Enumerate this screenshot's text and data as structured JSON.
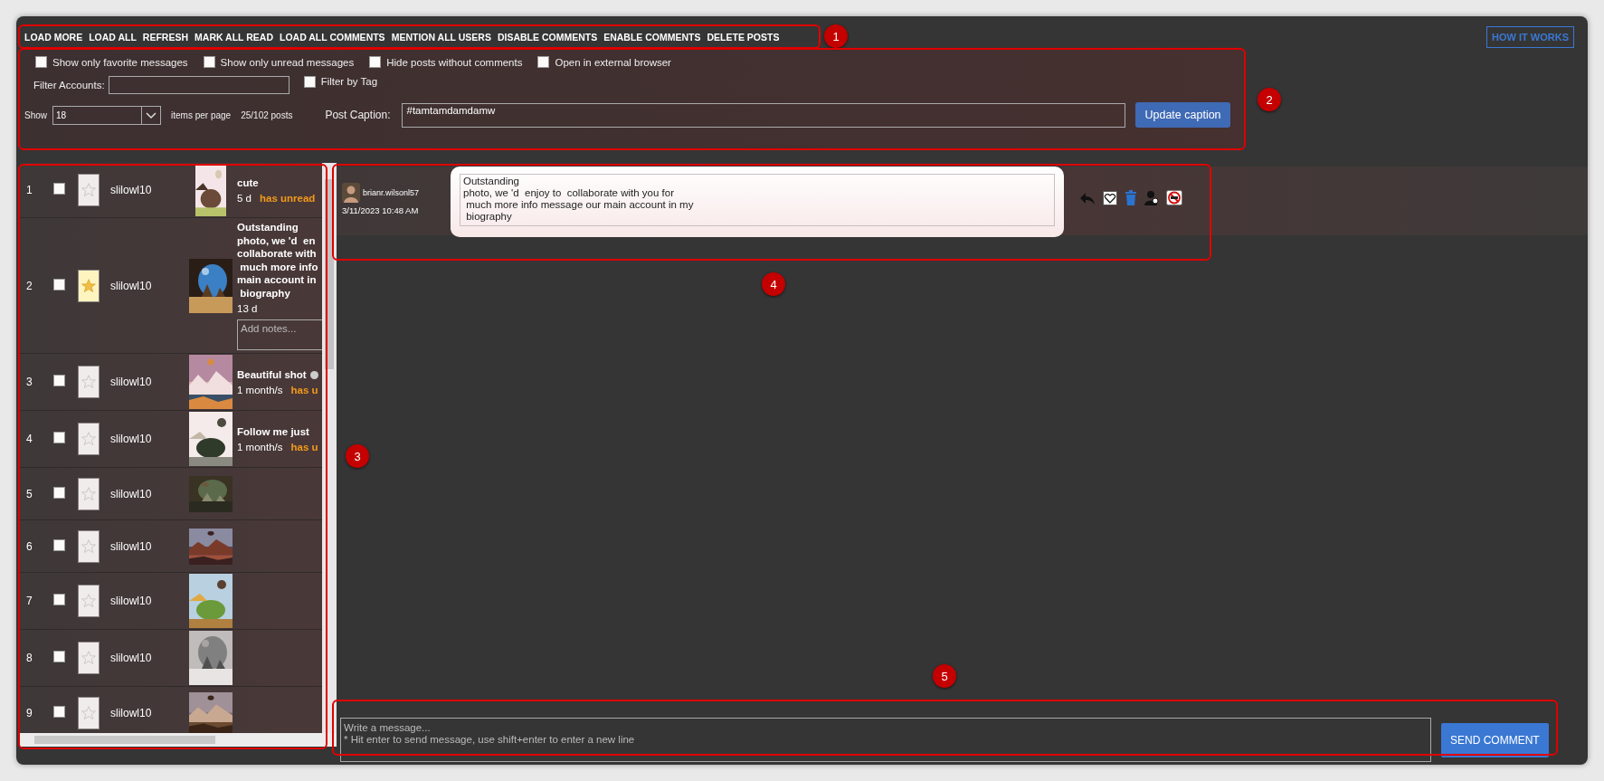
{
  "toolbar": {
    "actions": [
      "LOAD MORE",
      "LOAD ALL",
      "REFRESH",
      "MARK ALL READ",
      "LOAD ALL COMMENTS",
      "MENTION ALL USERS",
      "DISABLE COMMENTS",
      "ENABLE COMMENTS",
      "DELETE POSTS"
    ],
    "help_button": "HOW IT WORKS"
  },
  "filters": {
    "options": [
      {
        "label": "Show only favorite messages",
        "checked": false
      },
      {
        "label": "Show only unread messages",
        "checked": false
      },
      {
        "label": "Hide posts without comments",
        "checked": false
      },
      {
        "label": "Open in external browser",
        "checked": false
      }
    ],
    "filter_accounts": {
      "label": "Filter Accounts:"
    },
    "filter_by_tag": {
      "label": "Filter by Tag",
      "checked": false
    },
    "show_label": "Show",
    "page_size": "18",
    "items_per_page_label": "items per page",
    "post_count": "25/102 posts",
    "post_caption": {
      "label": "Post Caption:",
      "value": "#tamtamdamdamw"
    },
    "update_button": "Update caption"
  },
  "posts": [
    {
      "number": "1",
      "checked": false,
      "favorite": false,
      "username": "slilowl10",
      "title": "cute",
      "age": "5 d",
      "status": "has unread"
    },
    {
      "number": "2",
      "checked": false,
      "favorite": true,
      "username": "slilowl10",
      "title": "Outstanding\nphoto, we 'd  en\ncollaborate with\n much more info\nmain account in\n biography",
      "age": "13 d",
      "notes_placeholder": "Add notes..."
    },
    {
      "number": "3",
      "checked": false,
      "favorite": false,
      "username": "slilowl10",
      "title": "Beautiful shot",
      "emoji": true,
      "age": "1 month/s",
      "status": "has u"
    },
    {
      "number": "4",
      "checked": false,
      "favorite": false,
      "username": "slilowl10",
      "title": "Follow me just",
      "age": "1 month/s",
      "status": "has u"
    },
    {
      "number": "5",
      "checked": false,
      "favorite": false,
      "username": "slilowl10"
    },
    {
      "number": "6",
      "checked": false,
      "favorite": false,
      "username": "slilowl10"
    },
    {
      "number": "7",
      "checked": false,
      "favorite": false,
      "username": "slilowl10"
    },
    {
      "number": "8",
      "checked": false,
      "favorite": false,
      "username": "slilowl10"
    },
    {
      "number": "9",
      "checked": false,
      "favorite": false,
      "username": "slilowl10"
    }
  ],
  "thread": {
    "messages": [
      {
        "username": "brianr.wilsonl57",
        "timestamp": "3/11/2023 10:48 AM",
        "text": "Outstanding\nphoto, we 'd  enjoy to  collaborate with you for\n much more info message our main account in my\n biography"
      }
    ]
  },
  "composer": {
    "placeholder": "Write a message...\n* Hit enter to send message, use shift+enter to enter a new line",
    "send_button": "SEND COMMENT"
  },
  "callouts": [
    "1",
    "2",
    "3",
    "4",
    "5"
  ]
}
